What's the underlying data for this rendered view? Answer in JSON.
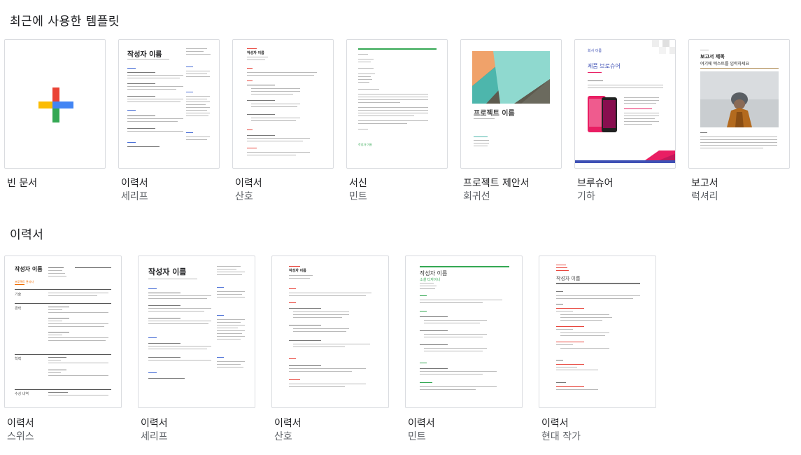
{
  "recent": {
    "title": "최근에 사용한 템플릿",
    "items": [
      {
        "name": "빈 문서",
        "sub": ""
      },
      {
        "name": "이력서",
        "sub": "세리프"
      },
      {
        "name": "이력서",
        "sub": "산호"
      },
      {
        "name": "서신",
        "sub": "민트"
      },
      {
        "name": "프로젝트 제안서",
        "sub": "회귀선"
      },
      {
        "name": "브루슈어",
        "sub": "기하"
      },
      {
        "name": "보고서",
        "sub": "럭셔리"
      }
    ]
  },
  "resume": {
    "title": "이력서",
    "items": [
      {
        "name": "이력서",
        "sub": "스위스"
      },
      {
        "name": "이력서",
        "sub": "세리프"
      },
      {
        "name": "이력서",
        "sub": "산호"
      },
      {
        "name": "이력서",
        "sub": "민트"
      },
      {
        "name": "이력서",
        "sub": "현대 작가"
      }
    ]
  },
  "thumbs": {
    "serif_name": "작성자 이름",
    "coral_name": "작성자 이름",
    "swiss_name": "작성자 이름",
    "swiss_role": "프로젝트 관리자",
    "swiss_sections": [
      "기술",
      "경력",
      "학력",
      "수상 내역"
    ],
    "mint_resume_name": "작성자 이름",
    "mint_resume_role": "소셜 디자이너",
    "modern_name": "작성자 이름",
    "proposal_title": "프로젝트 이름",
    "brochure_company": "회사 이름",
    "brochure_product": "제품 브로슈어",
    "report_title": "보고서 제목",
    "report_subtitle": "여기에 텍스트를 입력하세요",
    "letter_sender": "작성자 이름"
  },
  "colors": {
    "mint": "#34a853",
    "coral": "#e8453c",
    "swiss_accent": "#ef6c00",
    "brochure_blue": "#3f51b5",
    "brochure_pink": "#e91e63",
    "plus_blue": "#4285f4",
    "plus_red": "#ea4335",
    "plus_yellow": "#fbbc04",
    "plus_green": "#34a853"
  }
}
